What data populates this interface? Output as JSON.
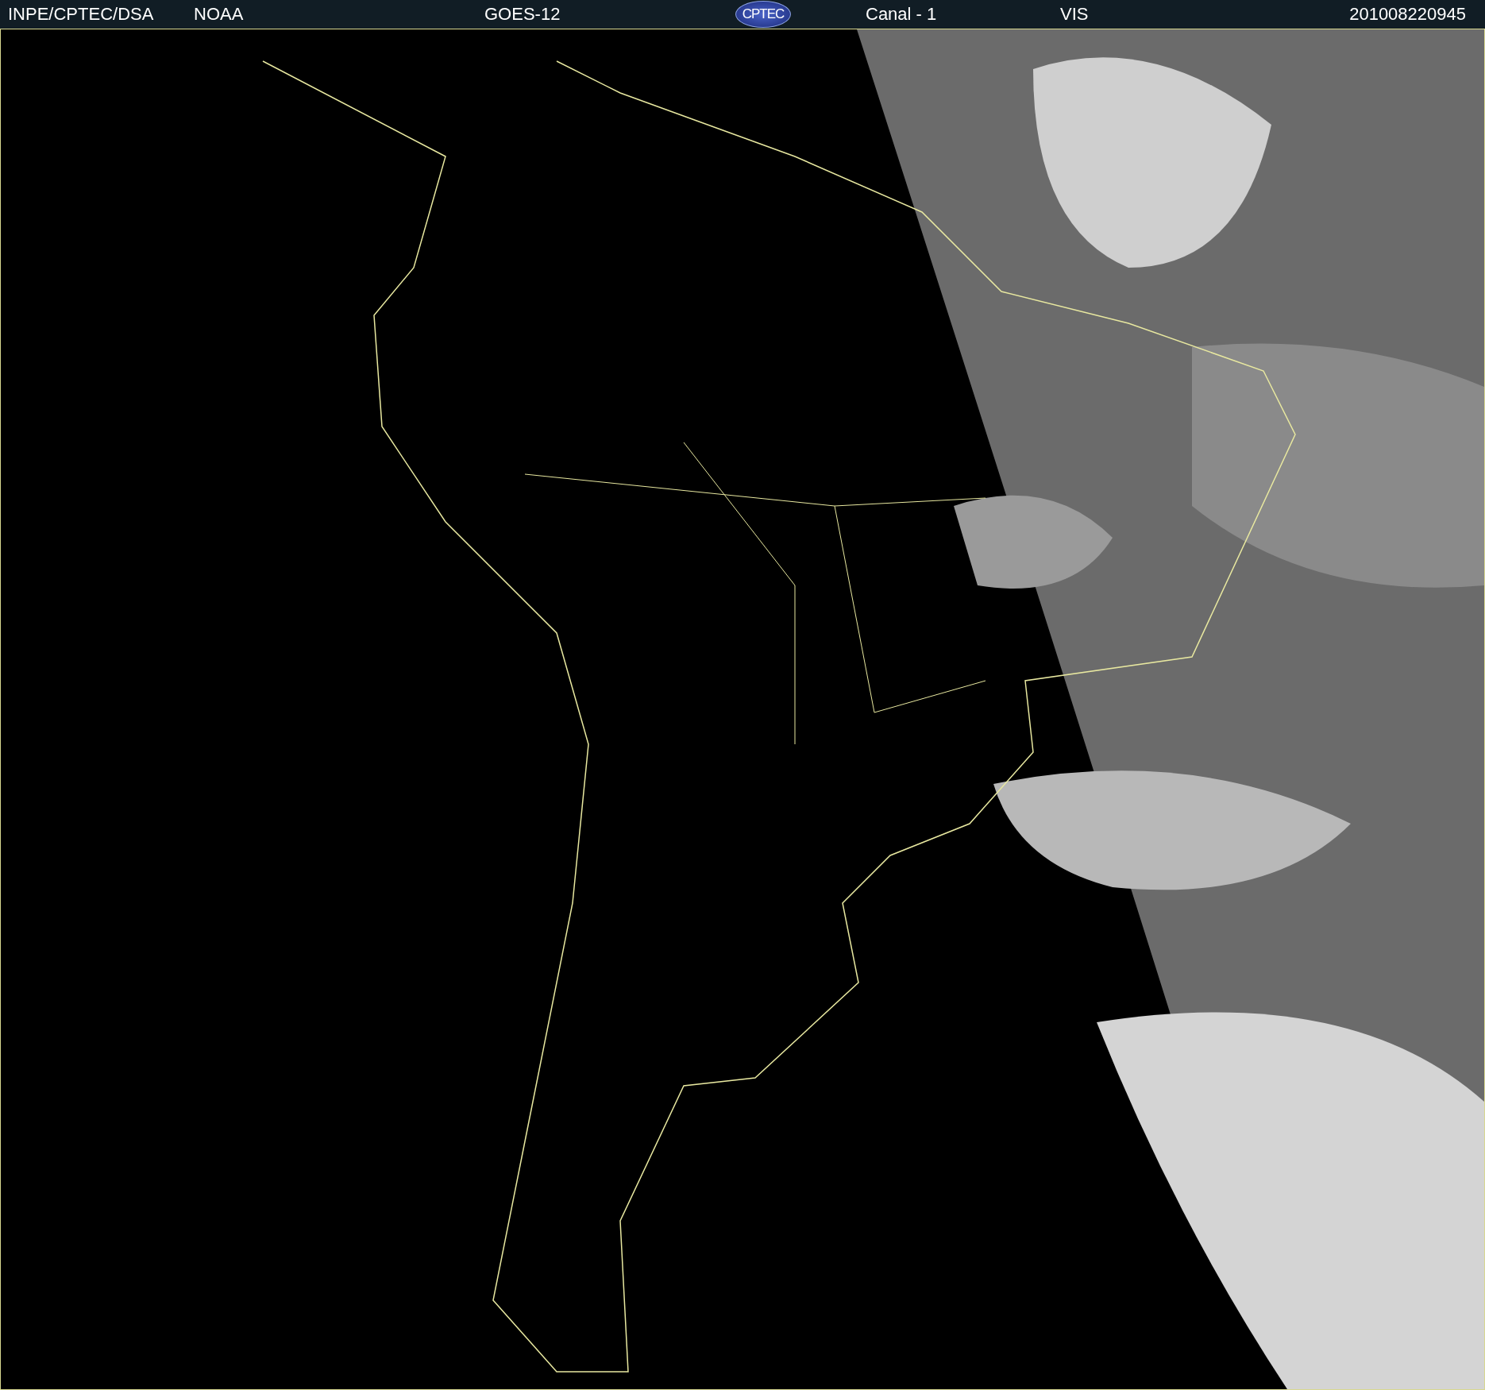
{
  "header": {
    "agency": "INPE/CPTEC/DSA",
    "source": "NOAA",
    "satellite": "GOES-12",
    "logo": "CPTEC",
    "channel": "Canal - 1",
    "band": "VIS",
    "timestamp": "201008220945"
  }
}
